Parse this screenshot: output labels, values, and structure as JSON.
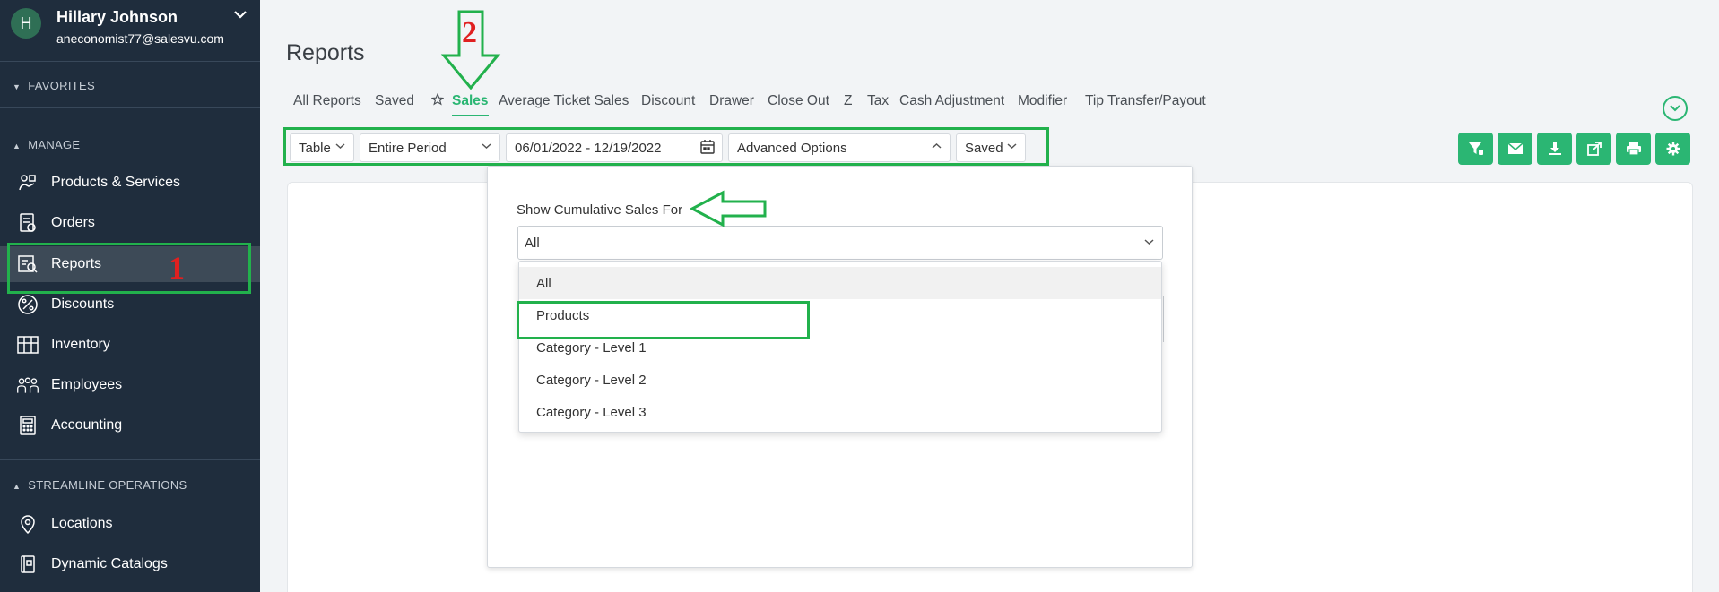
{
  "user": {
    "initial": "H",
    "name": "Hillary Johnson",
    "email": "aneconomist77@salesvu.com"
  },
  "sidebar": {
    "favorites_label": "FAVORITES",
    "manage_label": "MANAGE",
    "items": [
      {
        "label": "Products & Services",
        "icon": "products-icon"
      },
      {
        "label": "Orders",
        "icon": "orders-icon"
      },
      {
        "label": "Reports",
        "icon": "reports-icon"
      },
      {
        "label": "Discounts",
        "icon": "discount-icon"
      },
      {
        "label": "Inventory",
        "icon": "inventory-icon"
      },
      {
        "label": "Employees",
        "icon": "employees-icon"
      },
      {
        "label": "Accounting",
        "icon": "calculator-icon"
      }
    ],
    "streamline_label": "STREAMLINE OPERATIONS",
    "streamline_items": [
      {
        "label": "Locations",
        "icon": "location-pin-icon"
      },
      {
        "label": "Dynamic Catalogs",
        "icon": "catalog-icon"
      }
    ],
    "active_item": "Reports"
  },
  "page": {
    "title": "Reports"
  },
  "tabs": [
    {
      "label": "All Reports"
    },
    {
      "label": "Saved"
    },
    {
      "label": "Sales"
    },
    {
      "label": "Average Ticket Sales"
    },
    {
      "label": "Discount"
    },
    {
      "label": "Drawer"
    },
    {
      "label": "Close Out"
    },
    {
      "label": "Z"
    },
    {
      "label": "Tax"
    },
    {
      "label": "Cash Adjustment"
    },
    {
      "label": "Modifier"
    },
    {
      "label": "Tip Transfer/Payout"
    }
  ],
  "active_tab": "Sales",
  "controls": {
    "view": "Table",
    "period": "Entire Period",
    "date_range": "06/01/2022 - 12/19/2022",
    "advanced": "Advanced Options",
    "saved": "Saved"
  },
  "actions": [
    "filter-icon",
    "email-icon",
    "download-icon",
    "share-icon",
    "print-icon",
    "gear-icon"
  ],
  "cumulative": {
    "label": "Show Cumulative Sales For",
    "selected": "All",
    "options": [
      "All",
      "Products",
      "Category - Level 1",
      "Category - Level 2",
      "Category - Level 3"
    ]
  },
  "annotations": {
    "step1": "1",
    "step2": "2"
  },
  "colors": {
    "sidebar": "#1f2d3d",
    "accent": "#2bb673",
    "annotation_green": "#22b14c",
    "annotation_red": "#e02020"
  }
}
